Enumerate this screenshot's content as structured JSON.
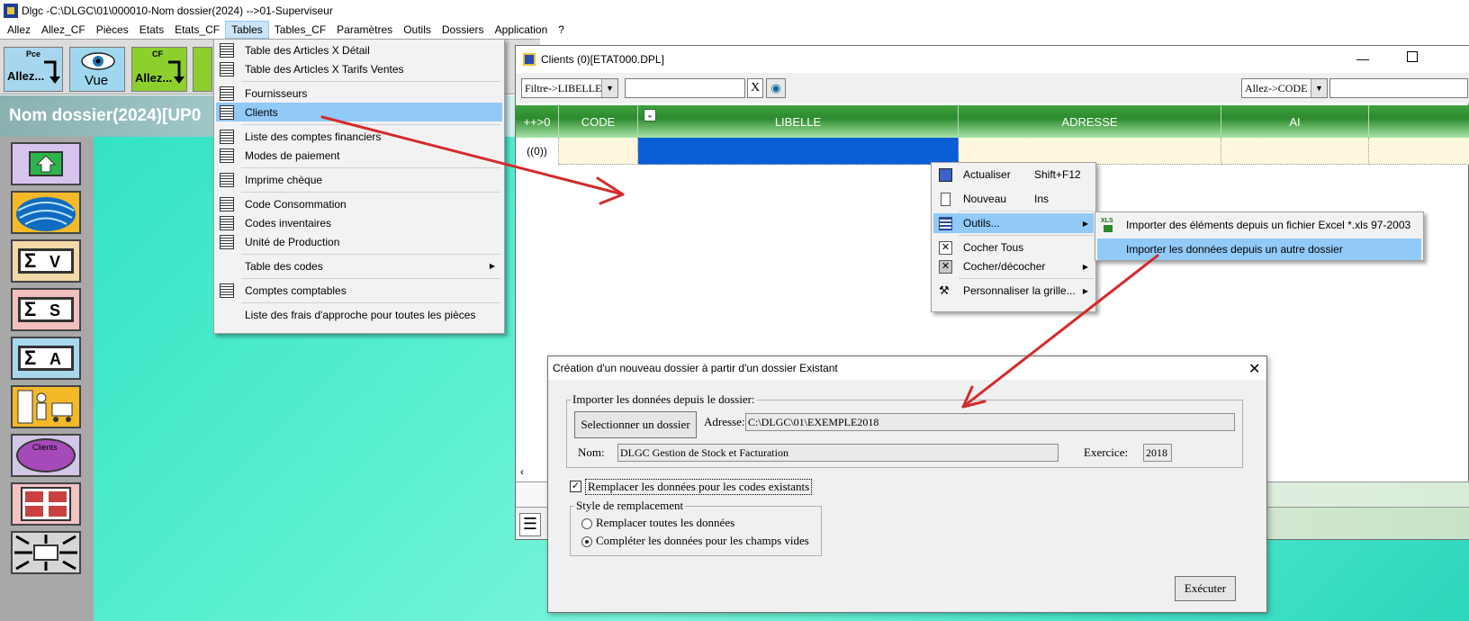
{
  "window": {
    "title": "Dlgc -C:\\DLGC\\01\\000010-Nom dossier(2024) -->01-Superviseur"
  },
  "menubar": [
    "Allez",
    "Allez_CF",
    "Pièces",
    "Etats",
    "Etats_CF",
    "Tables",
    "Tables_CF",
    "Paramètres",
    "Outils",
    "Dossiers",
    "Application",
    "?"
  ],
  "toolbar": {
    "pce_label": "Pce",
    "pce_allez": "Allez...",
    "vue_label": "Vue",
    "cf_label": "CF",
    "cf_allez": "Allez..."
  },
  "banner": {
    "text": "Nom dossier(2024)[UP0"
  },
  "left_launcher": {
    "sv_label": "V",
    "ss_label": "S",
    "sa_label": "A",
    "clients_label": "Clients"
  },
  "tables_menu": {
    "items": [
      "Table des Articles X Détail",
      "Table des Articles X Tarifs Ventes",
      "Fournisseurs",
      "Clients",
      "Liste des comptes financiers",
      "Modes de paiement",
      "Imprime chèque",
      "Code Consommation",
      "Codes inventaires",
      "Unité de Production",
      "Table des codes",
      "Comptes comptables",
      "Liste des frais d'approche pour toutes les pièces"
    ]
  },
  "clients_window": {
    "title": "Clients (0)[ETAT000.DPL]",
    "filter_combo": "Filtre->LIBELLE",
    "clear_label": "X",
    "goto_combo": "Allez->CODE",
    "columns": [
      "++>0",
      "CODE",
      "LIBELLE",
      "ADRESSE",
      "AI"
    ],
    "row_index": "((0))"
  },
  "context_menu": {
    "items": [
      {
        "label": "Actualiser",
        "shortcut": "Shift+F12"
      },
      {
        "label": "Nouveau",
        "shortcut": "Ins"
      },
      {
        "label": "Outils...",
        "shortcut": ""
      },
      {
        "label": "Cocher Tous",
        "shortcut": ""
      },
      {
        "label": "Cocher/décocher",
        "shortcut": ""
      },
      {
        "label": "Personnaliser la grille...",
        "shortcut": ""
      }
    ]
  },
  "outils_submenu": {
    "items": [
      "Importer des éléments depuis un fichier Excel *.xls 97-2003",
      "Importer les données depuis un autre dossier"
    ],
    "xls_icon": "XLS"
  },
  "dialog": {
    "title": "Création d'un nouveau dossier à partir d'un dossier Existant",
    "group_import": "Importer les données  depuis le dossier:",
    "select_button": "Selectionner un dossier",
    "address_label": "Adresse:",
    "address_value": "C:\\DLGC\\01\\EXEMPLE2018",
    "name_label": "Nom:",
    "name_value": "DLGC Gestion de Stock et Facturation",
    "exercice_label": "Exercice:",
    "exercice_value": "2018",
    "replace_checkbox": "Remplacer les données pour les codes existants",
    "style_group": "Style de remplacement",
    "radio_replace_all": "Remplacer toutes les données",
    "radio_complete": "Compléter les données pour les champs vides",
    "execute_button": "Exécuter"
  },
  "colors": {
    "arrow": "#d42a2a",
    "grid_header": "#2c8a2c",
    "selected_cell": "#0a5fd6",
    "menu_highlight": "#91c9f7"
  }
}
